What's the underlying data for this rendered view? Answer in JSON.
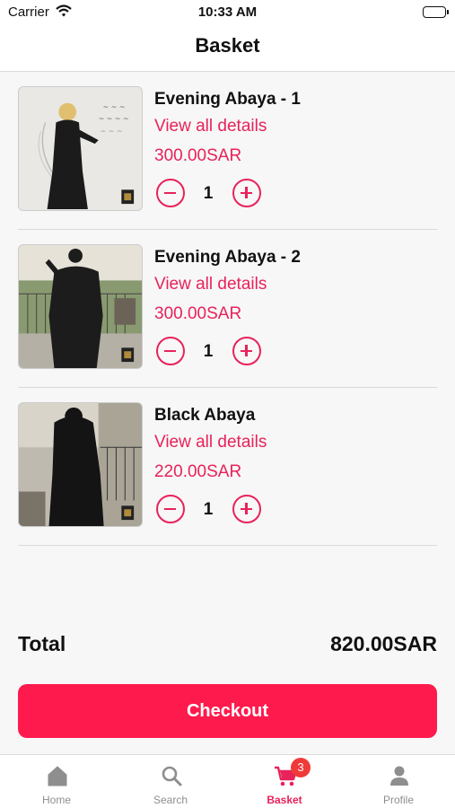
{
  "status_bar": {
    "carrier": "Carrier",
    "time": "10:33 AM"
  },
  "header": {
    "title": "Basket"
  },
  "basket": {
    "items": [
      {
        "title": "Evening Abaya - 1",
        "link_label": "View all details",
        "price": "300.00SAR",
        "quantity": "1"
      },
      {
        "title": "Evening Abaya - 2",
        "link_label": "View all details",
        "price": "300.00SAR",
        "quantity": "1"
      },
      {
        "title": "Black Abaya",
        "link_label": "View all details",
        "price": "220.00SAR",
        "quantity": "1"
      }
    ]
  },
  "summary": {
    "total_label": "Total",
    "total_value": "820.00SAR"
  },
  "checkout": {
    "label": "Checkout"
  },
  "tab_bar": {
    "tabs": [
      {
        "label": "Home",
        "icon": "home-icon"
      },
      {
        "label": "Search",
        "icon": "search-icon"
      },
      {
        "label": "Basket",
        "icon": "cart-icon",
        "badge": "3",
        "active": true
      },
      {
        "label": "Profile",
        "icon": "person-icon"
      }
    ]
  },
  "colors": {
    "accent": "#e8225a",
    "checkout": "#ff1a4d",
    "badge": "#f03a3a"
  }
}
